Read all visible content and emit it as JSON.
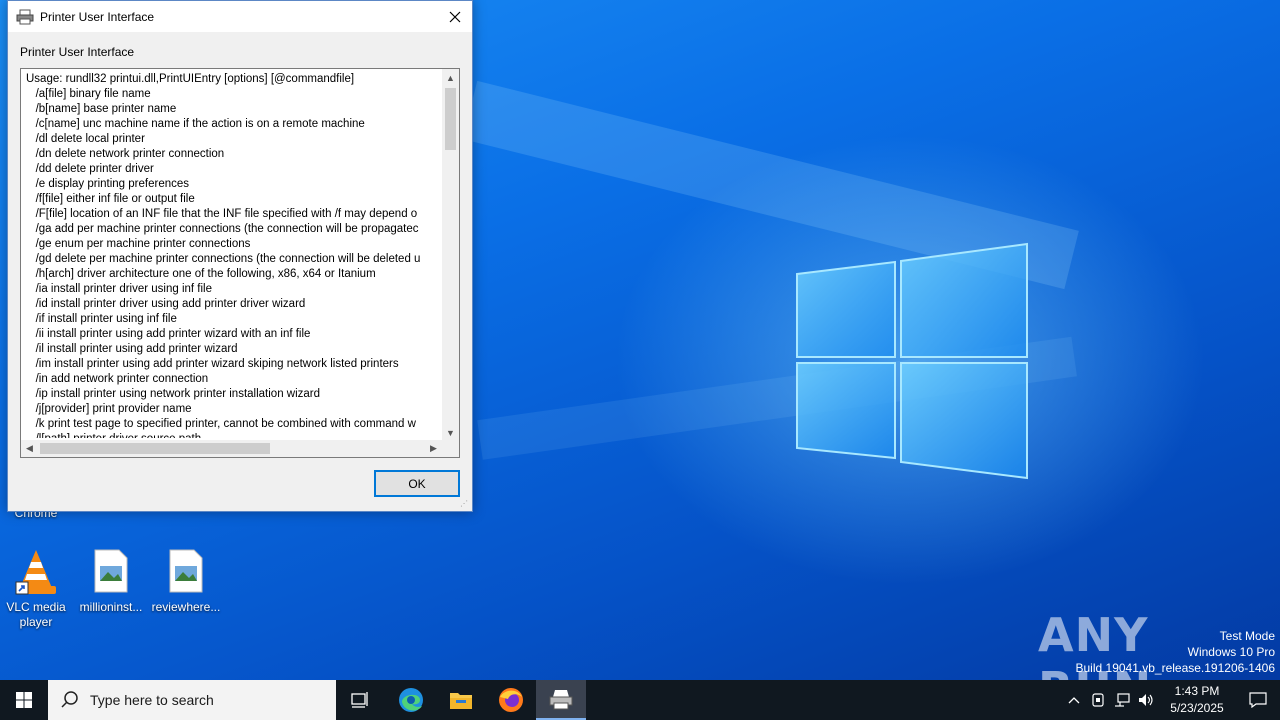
{
  "dialog": {
    "title": "Printer User Interface",
    "label": "Printer User Interface",
    "lines": [
      "Usage: rundll32 printui.dll,PrintUIEntry [options] [@commandfile]",
      "   /a[file] binary file name",
      "   /b[name] base printer name",
      "   /c[name] unc machine name if the action is on a remote machine",
      "   /dl delete local printer",
      "   /dn delete network printer connection",
      "   /dd delete printer driver",
      "   /e display printing preferences",
      "   /f[file] either inf file or output file",
      "   /F[file] location of an INF file that the INF file specified with /f may depend o",
      "   /ga add per machine printer connections (the connection will be propagatec",
      "   /ge enum per machine printer connections",
      "   /gd delete per machine printer connections (the connection will be deleted u",
      "   /h[arch] driver architecture one of the following, x86, x64 or Itanium",
      "   /ia install printer driver using inf file",
      "   /id install printer driver using add printer driver wizard",
      "   /if install printer using inf file",
      "   /ii install printer using add printer wizard with an inf file",
      "   /il install printer using add printer wizard",
      "   /im install printer using add printer wizard skiping network listed printers",
      "   /in add network printer connection",
      "   /ip install printer using network printer installation wizard",
      "   /j[provider] print provider name",
      "   /k print test page to specified printer, cannot be combined with command w",
      "   /l[path] printer driver source path"
    ],
    "ok_label": "OK"
  },
  "desktop": {
    "chrome_label": "Chrome",
    "icons": [
      {
        "label": "VLC media player",
        "icon": "vlc-icon"
      },
      {
        "label": "millioninst...",
        "icon": "image-file-icon"
      },
      {
        "label": "reviewhere...",
        "icon": "image-file-icon"
      }
    ]
  },
  "watermark": {
    "brand": "ANY RUN",
    "line1": "Test Mode",
    "line2": "Windows 10 Pro",
    "line3": "Build 19041.vb_release.191206-1406"
  },
  "taskbar": {
    "search_placeholder": "Type here to search",
    "pinned": [
      "task-view-icon",
      "edge-icon",
      "file-explorer-icon",
      "firefox-icon",
      "printer-icon"
    ],
    "time": "1:43 PM",
    "date": "5/23/2025"
  },
  "colors": {
    "accent": "#0078d7",
    "taskbar": "#101820",
    "desktop": "#0a6fe6"
  }
}
